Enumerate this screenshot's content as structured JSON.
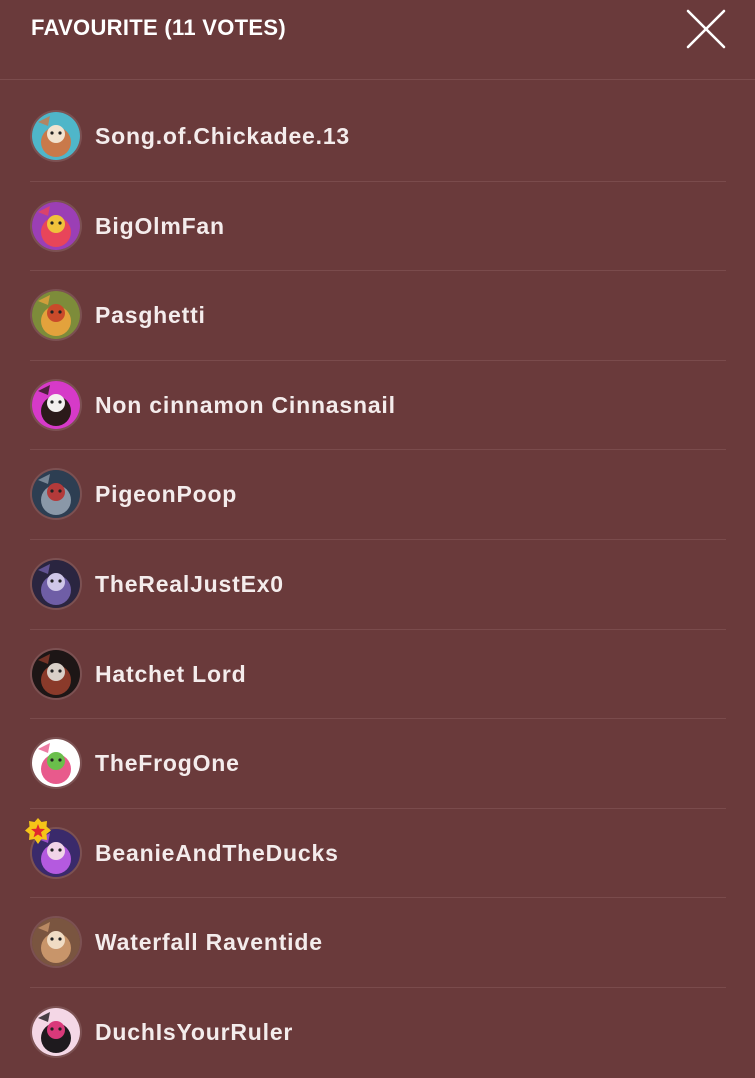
{
  "header": {
    "title": "FAVOURITE (11 VOTES)",
    "close_icon": "close-icon"
  },
  "colors": {
    "background": "#6a3a3b",
    "divider": "#7a4b4c",
    "text": "#f4ecec",
    "badge": "#f5c518",
    "badge_star": "#e0282e"
  },
  "voters": [
    {
      "name": "Song.of.Chickadee.13",
      "avatar": {
        "bg": "#4fb6c9",
        "fg": "#c9794a",
        "accent": "#f2e3cf"
      }
    },
    {
      "name": "BigOlmFan",
      "avatar": {
        "bg": "#9b3fb5",
        "fg": "#e8455a",
        "accent": "#f0c23b"
      }
    },
    {
      "name": "Pasghetti",
      "avatar": {
        "bg": "#7d8c3a",
        "fg": "#e3a23c",
        "accent": "#c94a2a"
      }
    },
    {
      "name": "Non cinnamon Cinnasnail",
      "avatar": {
        "bg": "#d63ac8",
        "fg": "#2b1a1a",
        "accent": "#f3f0ef"
      }
    },
    {
      "name": "PigeonPoop",
      "avatar": {
        "bg": "#2d3e52",
        "fg": "#8a98a8",
        "accent": "#b33a3a"
      }
    },
    {
      "name": "TheRealJustEx0",
      "avatar": {
        "bg": "#2a2540",
        "fg": "#6f5ea6",
        "accent": "#cfc7e8"
      }
    },
    {
      "name": "Hatchet Lord",
      "avatar": {
        "bg": "#1d1616",
        "fg": "#8a3a2a",
        "accent": "#d9d0c8"
      }
    },
    {
      "name": "TheFrogOne",
      "avatar": {
        "bg": "#ffffff",
        "fg": "#e85a8c",
        "accent": "#6abf4b"
      }
    },
    {
      "name": "BeanieAndTheDucks",
      "avatar": {
        "bg": "#3a2a6b",
        "fg": "#b45adf",
        "accent": "#f1d5e8"
      },
      "badge": "star-badge-icon"
    },
    {
      "name": "Waterfall Raventide",
      "avatar": {
        "bg": "#7a5540",
        "fg": "#c8956a",
        "accent": "#f0dcc4"
      }
    },
    {
      "name": "DuchIsYourRuler",
      "avatar": {
        "bg": "#f4d7e6",
        "fg": "#1e1a1e",
        "accent": "#d9397a"
      }
    }
  ]
}
